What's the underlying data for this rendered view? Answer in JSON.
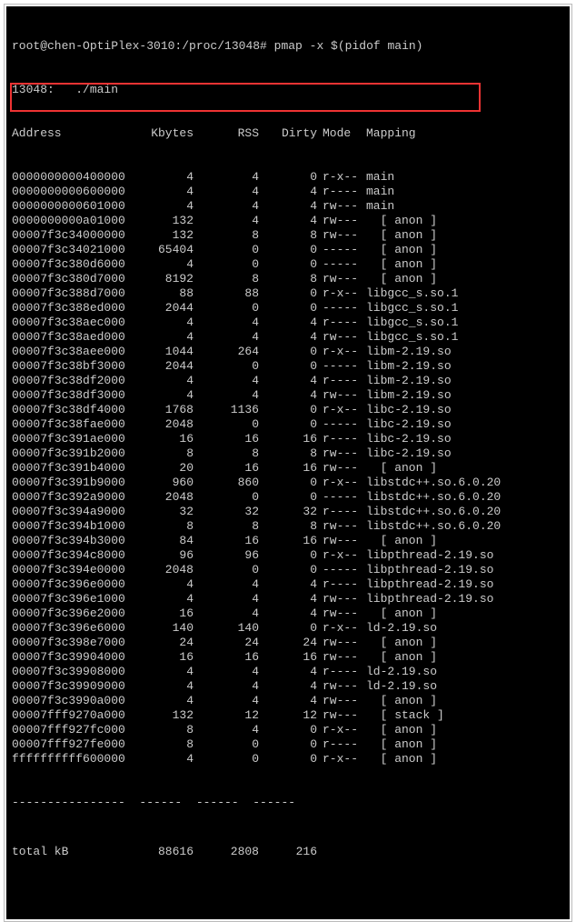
{
  "prompt_line": "root@chen-OptiPlex-3010:/proc/13048# pmap -x $(pidof main)",
  "proc_line": "13048:   ./main",
  "headers": {
    "addr": "Address",
    "kb": "Kbytes",
    "rss": "RSS",
    "dirty": "Dirty",
    "mode": "Mode",
    "map": "Mapping"
  },
  "rows": [
    {
      "addr": "0000000000400000",
      "kb": "4",
      "rss": "4",
      "dirty": "0",
      "mode": "r-x--",
      "map": "main"
    },
    {
      "addr": "0000000000600000",
      "kb": "4",
      "rss": "4",
      "dirty": "4",
      "mode": "r----",
      "map": "main"
    },
    {
      "addr": "0000000000601000",
      "kb": "4",
      "rss": "4",
      "dirty": "4",
      "mode": "rw---",
      "map": "main"
    },
    {
      "addr": "0000000000a01000",
      "kb": "132",
      "rss": "4",
      "dirty": "4",
      "mode": "rw---",
      "map": "  [ anon ]"
    },
    {
      "addr": "00007f3c34000000",
      "kb": "132",
      "rss": "8",
      "dirty": "8",
      "mode": "rw---",
      "map": "  [ anon ]"
    },
    {
      "addr": "00007f3c34021000",
      "kb": "65404",
      "rss": "0",
      "dirty": "0",
      "mode": "-----",
      "map": "  [ anon ]"
    },
    {
      "addr": "00007f3c380d6000",
      "kb": "4",
      "rss": "0",
      "dirty": "0",
      "mode": "-----",
      "map": "  [ anon ]"
    },
    {
      "addr": "00007f3c380d7000",
      "kb": "8192",
      "rss": "8",
      "dirty": "8",
      "mode": "rw---",
      "map": "  [ anon ]"
    },
    {
      "addr": "00007f3c388d7000",
      "kb": "88",
      "rss": "88",
      "dirty": "0",
      "mode": "r-x--",
      "map": "libgcc_s.so.1"
    },
    {
      "addr": "00007f3c388ed000",
      "kb": "2044",
      "rss": "0",
      "dirty": "0",
      "mode": "-----",
      "map": "libgcc_s.so.1"
    },
    {
      "addr": "00007f3c38aec000",
      "kb": "4",
      "rss": "4",
      "dirty": "4",
      "mode": "r----",
      "map": "libgcc_s.so.1"
    },
    {
      "addr": "00007f3c38aed000",
      "kb": "4",
      "rss": "4",
      "dirty": "4",
      "mode": "rw---",
      "map": "libgcc_s.so.1"
    },
    {
      "addr": "00007f3c38aee000",
      "kb": "1044",
      "rss": "264",
      "dirty": "0",
      "mode": "r-x--",
      "map": "libm-2.19.so"
    },
    {
      "addr": "00007f3c38bf3000",
      "kb": "2044",
      "rss": "0",
      "dirty": "0",
      "mode": "-----",
      "map": "libm-2.19.so"
    },
    {
      "addr": "00007f3c38df2000",
      "kb": "4",
      "rss": "4",
      "dirty": "4",
      "mode": "r----",
      "map": "libm-2.19.so"
    },
    {
      "addr": "00007f3c38df3000",
      "kb": "4",
      "rss": "4",
      "dirty": "4",
      "mode": "rw---",
      "map": "libm-2.19.so"
    },
    {
      "addr": "00007f3c38df4000",
      "kb": "1768",
      "rss": "1136",
      "dirty": "0",
      "mode": "r-x--",
      "map": "libc-2.19.so"
    },
    {
      "addr": "00007f3c38fae000",
      "kb": "2048",
      "rss": "0",
      "dirty": "0",
      "mode": "-----",
      "map": "libc-2.19.so"
    },
    {
      "addr": "00007f3c391ae000",
      "kb": "16",
      "rss": "16",
      "dirty": "16",
      "mode": "r----",
      "map": "libc-2.19.so"
    },
    {
      "addr": "00007f3c391b2000",
      "kb": "8",
      "rss": "8",
      "dirty": "8",
      "mode": "rw---",
      "map": "libc-2.19.so"
    },
    {
      "addr": "00007f3c391b4000",
      "kb": "20",
      "rss": "16",
      "dirty": "16",
      "mode": "rw---",
      "map": "  [ anon ]"
    },
    {
      "addr": "00007f3c391b9000",
      "kb": "960",
      "rss": "860",
      "dirty": "0",
      "mode": "r-x--",
      "map": "libstdc++.so.6.0.20"
    },
    {
      "addr": "00007f3c392a9000",
      "kb": "2048",
      "rss": "0",
      "dirty": "0",
      "mode": "-----",
      "map": "libstdc++.so.6.0.20"
    },
    {
      "addr": "00007f3c394a9000",
      "kb": "32",
      "rss": "32",
      "dirty": "32",
      "mode": "r----",
      "map": "libstdc++.so.6.0.20"
    },
    {
      "addr": "00007f3c394b1000",
      "kb": "8",
      "rss": "8",
      "dirty": "8",
      "mode": "rw---",
      "map": "libstdc++.so.6.0.20"
    },
    {
      "addr": "00007f3c394b3000",
      "kb": "84",
      "rss": "16",
      "dirty": "16",
      "mode": "rw---",
      "map": "  [ anon ]"
    },
    {
      "addr": "00007f3c394c8000",
      "kb": "96",
      "rss": "96",
      "dirty": "0",
      "mode": "r-x--",
      "map": "libpthread-2.19.so"
    },
    {
      "addr": "00007f3c394e0000",
      "kb": "2048",
      "rss": "0",
      "dirty": "0",
      "mode": "-----",
      "map": "libpthread-2.19.so"
    },
    {
      "addr": "00007f3c396e0000",
      "kb": "4",
      "rss": "4",
      "dirty": "4",
      "mode": "r----",
      "map": "libpthread-2.19.so"
    },
    {
      "addr": "00007f3c396e1000",
      "kb": "4",
      "rss": "4",
      "dirty": "4",
      "mode": "rw---",
      "map": "libpthread-2.19.so"
    },
    {
      "addr": "00007f3c396e2000",
      "kb": "16",
      "rss": "4",
      "dirty": "4",
      "mode": "rw---",
      "map": "  [ anon ]"
    },
    {
      "addr": "00007f3c396e6000",
      "kb": "140",
      "rss": "140",
      "dirty": "0",
      "mode": "r-x--",
      "map": "ld-2.19.so"
    },
    {
      "addr": "00007f3c398e7000",
      "kb": "24",
      "rss": "24",
      "dirty": "24",
      "mode": "rw---",
      "map": "  [ anon ]"
    },
    {
      "addr": "00007f3c39904000",
      "kb": "16",
      "rss": "16",
      "dirty": "16",
      "mode": "rw---",
      "map": "  [ anon ]"
    },
    {
      "addr": "00007f3c39908000",
      "kb": "4",
      "rss": "4",
      "dirty": "4",
      "mode": "r----",
      "map": "ld-2.19.so"
    },
    {
      "addr": "00007f3c39909000",
      "kb": "4",
      "rss": "4",
      "dirty": "4",
      "mode": "rw---",
      "map": "ld-2.19.so"
    },
    {
      "addr": "00007f3c3990a000",
      "kb": "4",
      "rss": "4",
      "dirty": "4",
      "mode": "rw---",
      "map": "  [ anon ]"
    },
    {
      "addr": "00007fff9270a000",
      "kb": "132",
      "rss": "12",
      "dirty": "12",
      "mode": "rw---",
      "map": "  [ stack ]"
    },
    {
      "addr": "00007fff927fc000",
      "kb": "8",
      "rss": "4",
      "dirty": "0",
      "mode": "r-x--",
      "map": "  [ anon ]"
    },
    {
      "addr": "00007fff927fe000",
      "kb": "8",
      "rss": "0",
      "dirty": "0",
      "mode": "r----",
      "map": "  [ anon ]"
    },
    {
      "addr": "ffffffffff600000",
      "kb": "4",
      "rss": "0",
      "dirty": "0",
      "mode": "r-x--",
      "map": "  [ anon ]"
    }
  ],
  "sep": "----------------  ------  ------  ------",
  "total": {
    "label": "total kB",
    "kb": "88616",
    "rss": "2808",
    "dirty": "216"
  }
}
